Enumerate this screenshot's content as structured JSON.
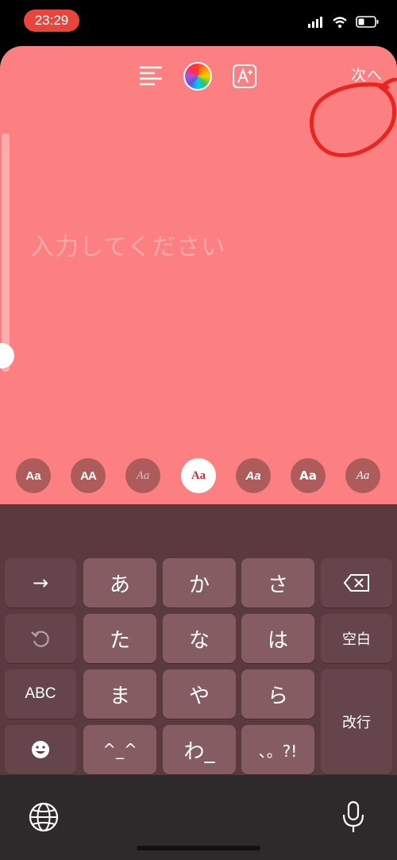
{
  "status_bar": {
    "time": "23:29"
  },
  "toolbar": {
    "next_label": "次へ"
  },
  "canvas": {
    "placeholder": "入力してください"
  },
  "font_styles": [
    "Aa",
    "AA",
    "Aa",
    "Aa",
    "Aa",
    "Aa",
    "Aa"
  ],
  "selected_font_index": 3,
  "keyboard": {
    "arrow_key": "→",
    "kana_row1": [
      "あ",
      "か",
      "さ"
    ],
    "kana_row2": [
      "た",
      "な",
      "は"
    ],
    "kana_row3": [
      "ま",
      "や",
      "ら"
    ],
    "abc_label": "ABC",
    "space_label": "空白",
    "return_label": "改行",
    "emoticon_label": "^_^",
    "wa_label": "わ_",
    "punct_label": "、。?!"
  },
  "colors": {
    "canvas_bg": "#fc8082",
    "annotation": "#e8261f",
    "selected_font_text": "#c0303a"
  }
}
